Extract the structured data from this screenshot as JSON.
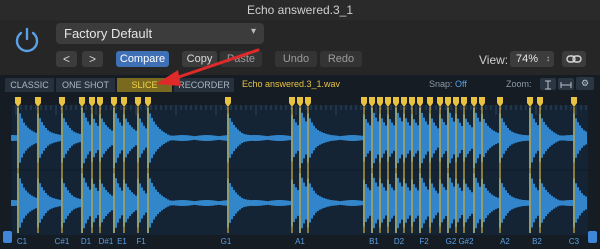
{
  "window": {
    "title": "Echo answered.3_1"
  },
  "header": {
    "preset": "Factory Default",
    "prev": "<",
    "next": ">",
    "compare": "Compare",
    "copy": "Copy",
    "paste": "Paste",
    "undo": "Undo",
    "redo": "Redo",
    "view_label": "View:",
    "zoom_value": "74%"
  },
  "panel": {
    "modes": [
      "CLASSIC",
      "ONE SHOT",
      "SLICE",
      "RECORDER"
    ],
    "selected_mode": "SLICE",
    "filename": "Echo answered.3_1.wav",
    "snap_label": "Snap:",
    "snap_value": "Off",
    "zoom_label": "Zoom:",
    "note_labels": [
      "C1",
      "C#1",
      "D1",
      "D#1",
      "E1",
      "F1",
      "G1",
      "A1",
      "B1",
      "D2",
      "F2",
      "G2",
      "G#2",
      "A2",
      "B2",
      "C3"
    ]
  },
  "colors": {
    "waveform": "#3a9ef0",
    "slice_marker": "#e8c341",
    "accent": "#3f6fb6",
    "arrow": "#e02a2a"
  }
}
